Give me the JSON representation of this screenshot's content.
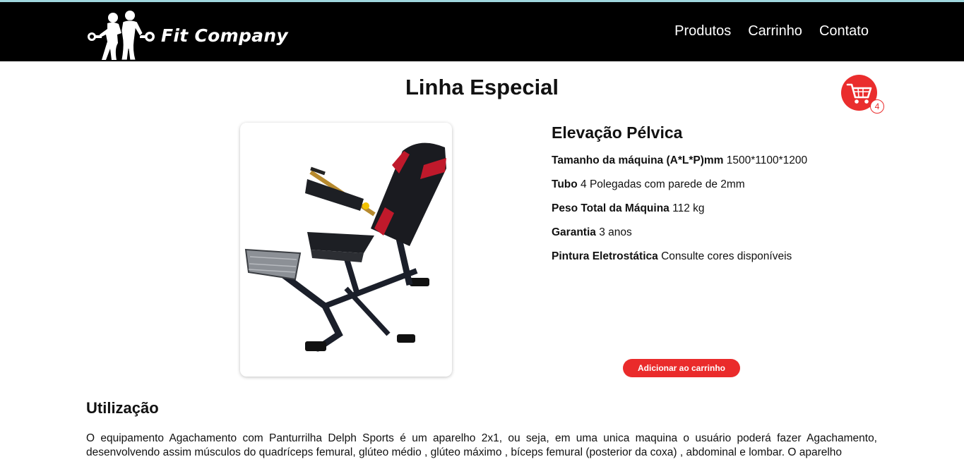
{
  "brand": {
    "name": "Fit Company",
    "logo_icon": "fitness-couple-dumbbell-icon"
  },
  "nav": {
    "items": [
      "Produtos",
      "Carrinho",
      "Contato"
    ]
  },
  "page": {
    "title": "Linha Especial"
  },
  "cart": {
    "icon": "shopping-cart-icon",
    "count": "4",
    "color": "#ea2d2d"
  },
  "product": {
    "name": "Elevação Pélvica",
    "image_icon": "pelvic-elevation-machine",
    "specs": [
      {
        "label": "Tamanho da máquina (A*L*P)mm",
        "value": "1500*1100*1200"
      },
      {
        "label": "Tubo",
        "value": "4 Polegadas com parede de 2mm"
      },
      {
        "label": "Peso Total da Máquina",
        "value": "112 kg"
      },
      {
        "label": "Garantia",
        "value": "3 anos"
      },
      {
        "label": "Pintura Eletrostática",
        "value": "Consulte cores disponíveis"
      }
    ],
    "add_button": "Adicionar ao carrinho"
  },
  "usage": {
    "title": "Utilização",
    "text": "O equipamento Agachamento com Panturrilha Delph Sports é um aparelho 2x1, ou seja, em uma unica maquina o usuário poderá fazer Agachamento, desenvolvendo assim músculos do quadríceps femural, glúteo médio , glúteo máximo , bíceps femural (posterior da coxa) , abdominal e lombar. O aparelho"
  },
  "colors": {
    "navbar": "#000000",
    "accent": "#ea2b2b"
  }
}
